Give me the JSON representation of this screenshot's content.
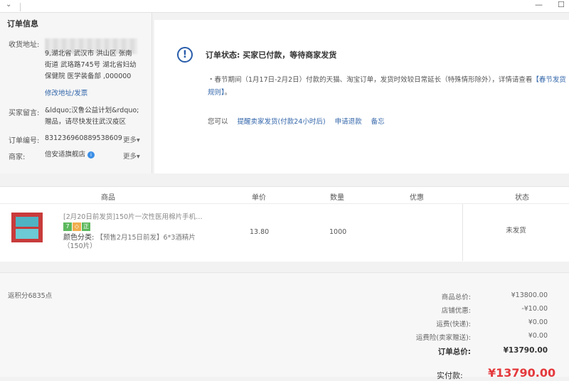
{
  "window": {
    "minimize": "—",
    "maximize": "☐"
  },
  "order_info": {
    "heading": "订单信息",
    "address_label": "收货地址:",
    "address_text": "9,湖北省 武汉市 洪山区 张南街道 武珞路745号 湖北省妇幼保健院 医学装备部 ,000000",
    "address_lines": [
      "9,湖北省 武汉市 洪山区 张南",
      "街道 武珞路745号 湖北省妇幼",
      "保健院 医学装备部 ,000000"
    ],
    "edit_link": "修改地址/发票",
    "message_label": "买家留言:",
    "message_lines": [
      "&ldquo;汉鲁公益计划&rdquo;",
      "赠品，请尽快发往武汉疫区"
    ],
    "order_no_label": "订单编号:",
    "order_no": "831236960889538609",
    "more": "更多",
    "merchant_label": "商家:",
    "merchant_name": "倍安适旗舰店",
    "merchant_badge": "i"
  },
  "status": {
    "icon": "!",
    "title": "订单状态: 买家已付款，等待商家发货",
    "notice_main": "・春节期间（1月17日-2月2日）付款的天猫、淘宝订单，发货时效较日常延长（特殊情形除外），详情请查看",
    "notice_link": "【春节发货规则】",
    "notice_end": "。",
    "actions_prefix": "您可以",
    "actions": [
      "提醒卖家发货(付款24小时后)",
      "申请退款",
      "备忘"
    ]
  },
  "goods": {
    "headers": [
      "商品",
      "单价",
      "数量",
      "优惠",
      "状态"
    ],
    "items": [
      {
        "title": "[2月20日前发货]150片一次性医用棉片手机…",
        "tags": [
          "7",
          "◇",
          "正"
        ],
        "spec_key": "颜色分类:",
        "spec_value": "【预售2月15日前发】6*3酒精片（150片）",
        "price": "13.80",
        "quantity": "1000",
        "status": "未发货"
      }
    ]
  },
  "summary": {
    "points": "返积分6835点",
    "rows": [
      {
        "label": "商品总价:",
        "value": "¥13800.00"
      },
      {
        "label": "店铺优惠:",
        "value": "-¥10.00"
      },
      {
        "label": "运费(快递):",
        "value": "¥0.00"
      },
      {
        "label": "运费险(卖家赠送):",
        "value": "¥0.00"
      }
    ],
    "total_label": "订单总价:",
    "total_value": "¥13790.00",
    "pay_label": "实付款:",
    "pay_value": "¥13790.00"
  },
  "colors": {
    "link": "#3366aa",
    "price_red": "#e4393c",
    "tag_green": "#5cb85c"
  }
}
